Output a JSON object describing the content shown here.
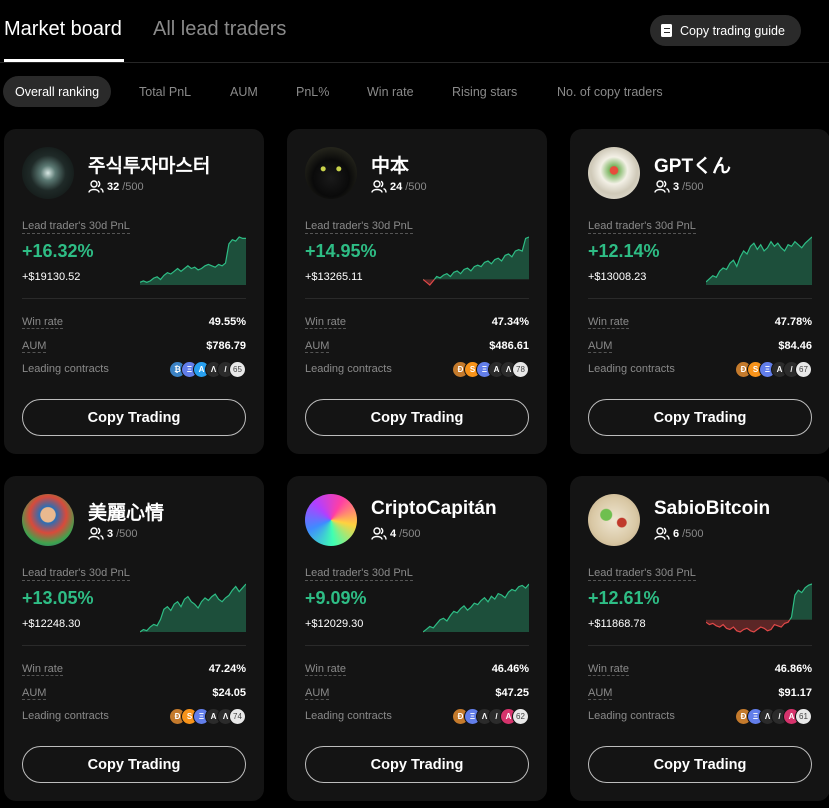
{
  "header": {
    "tabs": [
      {
        "label": "Market board",
        "active": true
      },
      {
        "label": "All lead traders",
        "active": false
      }
    ],
    "guide_button": "Copy trading guide"
  },
  "filters": [
    {
      "label": "Overall ranking",
      "active": true
    },
    {
      "label": "Total PnL"
    },
    {
      "label": "AUM"
    },
    {
      "label": "PnL%"
    },
    {
      "label": "Win rate"
    },
    {
      "label": "Rising stars"
    },
    {
      "label": "No. of copy traders"
    }
  ],
  "labels": {
    "pnl_label": "Lead trader's 30d PnL",
    "win_rate": "Win rate",
    "aum": "AUM",
    "leading_contracts": "Leading contracts",
    "copy_button": "Copy Trading"
  },
  "colors": {
    "positive": "#2ebd85",
    "negative": "#e04848",
    "card_bg": "#141414"
  },
  "traders": [
    {
      "name": "주식투자마스터",
      "copiers": "32",
      "capacity": "/500",
      "pnl_pct": "+16.32%",
      "pnl_usd": "+$19130.52",
      "win_rate": "49.55%",
      "aum": "$786.79",
      "coins": [
        {
          "icon": "btc-icon",
          "color": "#3b82c4"
        },
        {
          "icon": "eth-icon",
          "color": "#627eea"
        },
        {
          "icon": "arb-icon",
          "color": "#28a0f0"
        },
        {
          "icon": "aave-icon",
          "color": "#2b2b2b"
        },
        {
          "icon": "n-icon",
          "color": "#2b2b2b"
        }
      ],
      "coins_more": "65",
      "sparkline": [
        2,
        3,
        2,
        3,
        5,
        6,
        4,
        7,
        9,
        8,
        10,
        12,
        10,
        12,
        14,
        12,
        13,
        11,
        12,
        14,
        15,
        14,
        13,
        15,
        14,
        16,
        30,
        33,
        32,
        35,
        34,
        34
      ]
    },
    {
      "name": "中本",
      "copiers": "24",
      "capacity": "/500",
      "pnl_pct": "+14.95%",
      "pnl_usd": "+$13265.11",
      "win_rate": "47.34%",
      "aum": "$486.61",
      "coins": [
        {
          "icon": "doge-icon",
          "color": "#c47a2c"
        },
        {
          "icon": "sol-icon",
          "color": "#f7931a"
        },
        {
          "icon": "eth-icon",
          "color": "#627eea"
        },
        {
          "icon": "arb-icon",
          "color": "#2b2b2b"
        },
        {
          "icon": "aave-icon",
          "color": "#2b2b2b"
        }
      ],
      "coins_more": "78",
      "sparkline": [
        0,
        -2,
        -4,
        -1,
        2,
        1,
        3,
        4,
        2,
        5,
        6,
        4,
        7,
        8,
        6,
        9,
        10,
        9,
        12,
        13,
        11,
        14,
        15,
        13,
        17,
        18,
        16,
        20,
        21,
        20,
        29,
        30
      ]
    },
    {
      "name": "GPTくん",
      "copiers": "3",
      "capacity": "/500",
      "pnl_pct": "+12.14%",
      "pnl_usd": "+$13008.23",
      "win_rate": "47.78%",
      "aum": "$84.46",
      "coins": [
        {
          "icon": "doge-icon",
          "color": "#c47a2c"
        },
        {
          "icon": "sol-icon",
          "color": "#f7931a"
        },
        {
          "icon": "eth-icon",
          "color": "#627eea"
        },
        {
          "icon": "arb-icon",
          "color": "#2b2b2b"
        },
        {
          "icon": "n-icon",
          "color": "#2b2b2b"
        }
      ],
      "coins_more": "67",
      "sparkline": [
        2,
        4,
        6,
        5,
        9,
        11,
        10,
        14,
        16,
        12,
        18,
        22,
        20,
        25,
        27,
        23,
        26,
        22,
        24,
        28,
        25,
        27,
        24,
        22,
        26,
        25,
        28,
        26,
        24,
        27,
        29,
        31
      ]
    },
    {
      "name": "美麗心情",
      "copiers": "3",
      "capacity": "/500",
      "pnl_pct": "+13.05%",
      "pnl_usd": "+$12248.30",
      "win_rate": "47.24%",
      "aum": "$24.05",
      "coins": [
        {
          "icon": "doge-icon",
          "color": "#c47a2c"
        },
        {
          "icon": "sol-icon",
          "color": "#f7931a"
        },
        {
          "icon": "eth-icon",
          "color": "#627eea"
        },
        {
          "icon": "arb-icon",
          "color": "#2b2b2b"
        },
        {
          "icon": "aave-icon",
          "color": "#2b2b2b"
        }
      ],
      "coins_more": "74",
      "sparkline": [
        0,
        2,
        1,
        4,
        6,
        5,
        10,
        18,
        20,
        17,
        22,
        24,
        20,
        26,
        28,
        24,
        22,
        19,
        24,
        27,
        25,
        28,
        30,
        26,
        24,
        27,
        29,
        33,
        36,
        32,
        35,
        38
      ]
    },
    {
      "name": "CriptoCapitán",
      "copiers": "4",
      "capacity": "/500",
      "pnl_pct": "+9.09%",
      "pnl_usd": "+$12029.30",
      "win_rate": "46.46%",
      "aum": "$47.25",
      "coins": [
        {
          "icon": "doge-icon",
          "color": "#c47a2c"
        },
        {
          "icon": "eth-icon",
          "color": "#627eea"
        },
        {
          "icon": "aave-icon",
          "color": "#2b2b2b"
        },
        {
          "icon": "n-icon",
          "color": "#2b2b2b"
        },
        {
          "icon": "ape-icon",
          "color": "#d6336c"
        }
      ],
      "coins_more": "62",
      "sparkline": [
        0,
        2,
        4,
        3,
        6,
        9,
        10,
        8,
        12,
        15,
        14,
        17,
        19,
        16,
        18,
        21,
        20,
        23,
        25,
        22,
        26,
        24,
        28,
        27,
        25,
        29,
        31,
        30,
        33,
        34,
        32,
        35
      ]
    },
    {
      "name": "SabioBitcoin",
      "copiers": "6",
      "capacity": "/500",
      "pnl_pct": "+12.61%",
      "pnl_usd": "+$11868.78",
      "win_rate": "46.86%",
      "aum": "$91.17",
      "coins": [
        {
          "icon": "doge-icon",
          "color": "#c47a2c"
        },
        {
          "icon": "eth-icon",
          "color": "#627eea"
        },
        {
          "icon": "aave-icon",
          "color": "#2b2b2b"
        },
        {
          "icon": "n-icon",
          "color": "#2b2b2b"
        },
        {
          "icon": "ape-icon",
          "color": "#d6336c"
        }
      ],
      "coins_more": "61",
      "sparkline": [
        -2,
        -4,
        -3,
        -5,
        -6,
        -4,
        -7,
        -8,
        -6,
        -9,
        -10,
        -8,
        -7,
        -9,
        -10,
        -8,
        -6,
        -7,
        -9,
        -8,
        -4,
        -5,
        -6,
        -3,
        -2,
        2,
        20,
        24,
        22,
        26,
        28,
        29
      ]
    }
  ]
}
